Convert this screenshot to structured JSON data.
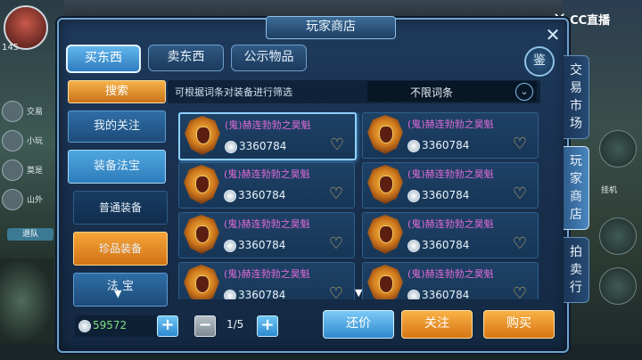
{
  "window": {
    "title": "玩家商店",
    "close_icon": "close-icon"
  },
  "tabs": [
    {
      "label": "买东西",
      "active": true
    },
    {
      "label": "卖东西",
      "active": false
    },
    {
      "label": "公示物品",
      "active": false
    }
  ],
  "jian_button": "鉴",
  "filter": {
    "hint": "可根据词条对装备进行筛选",
    "selected": "不限词条"
  },
  "categories": {
    "search": "搜索",
    "my_follow": "我的关注",
    "equip_treasure": "装备法宝",
    "normal_equip": "普通装备",
    "rare_equip": "珍品装备",
    "treasure": "法 宝"
  },
  "items": [
    {
      "name": "(鬼)赫连勃勃之昊魁",
      "price": "3360784",
      "selected": true
    },
    {
      "name": "(鬼)赫连勃勃之昊魁",
      "price": "3360784",
      "selected": false
    },
    {
      "name": "(鬼)赫连勃勃之昊魁",
      "price": "3360784",
      "selected": false
    },
    {
      "name": "(鬼)赫连勃勃之昊魁",
      "price": "3360784",
      "selected": false
    },
    {
      "name": "(鬼)赫连勃勃之昊魁",
      "price": "3360784",
      "selected": false
    },
    {
      "name": "(鬼)赫连勃勃之昊魁",
      "price": "3360784",
      "selected": false
    },
    {
      "name": "(鬼)赫连勃勃之昊魁",
      "price": "3360784",
      "selected": false
    },
    {
      "name": "(鬼)赫连勃勃之昊魁",
      "price": "3360784",
      "selected": false
    }
  ],
  "bottom": {
    "coins": "59572",
    "page": "1/5",
    "bargain": "还价",
    "follow": "关注",
    "buy": "购买"
  },
  "side_tabs": [
    "交易市场",
    "玩家商店",
    "拍卖行"
  ],
  "background": {
    "avatar_level": "145",
    "right_label": "挂机",
    "side_texts": [
      "交易",
      "小玩",
      "莫是",
      "山外",
      "退队"
    ],
    "cc_logo": "CC直播"
  },
  "colors": {
    "accent_orange": "#f2a23a",
    "accent_blue": "#4fa7df",
    "item_name": "#e06bd8",
    "coin_text": "#7fe07f"
  }
}
